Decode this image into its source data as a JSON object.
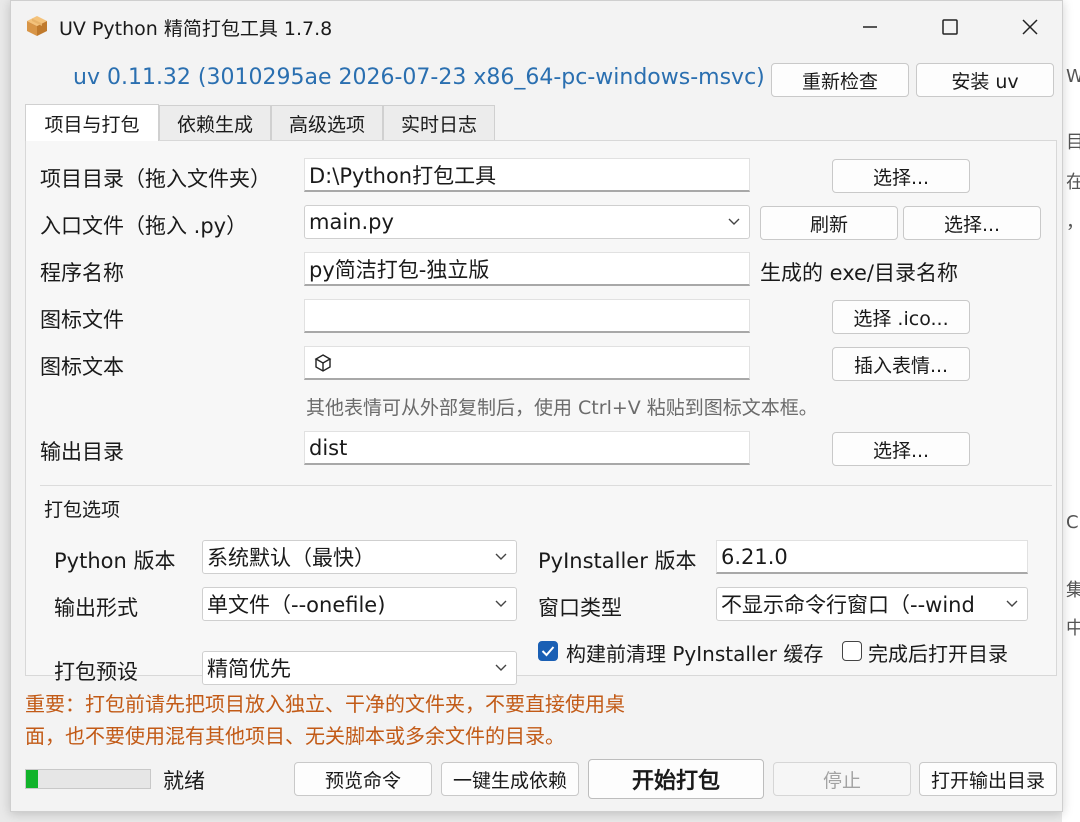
{
  "window": {
    "title": "UV Python 精简打包工具 1.7.8"
  },
  "header": {
    "version": "uv 0.11.32 (3010295ae 2026-07-23 x86_64-pc-windows-msvc)",
    "recheck_label": "重新检查",
    "install_label": "安装 uv"
  },
  "tabs": [
    {
      "label": "项目与打包",
      "active": true
    },
    {
      "label": "依赖生成",
      "active": false
    },
    {
      "label": "高级选项",
      "active": false
    },
    {
      "label": "实时日志",
      "active": false
    }
  ],
  "form": {
    "project_dir": {
      "label": "项目目录（拖入文件夹）",
      "value": "D:\\Python打包工具",
      "button": "选择..."
    },
    "entry_file": {
      "label": "入口文件（拖入 .py）",
      "value": "main.py",
      "refresh": "刷新",
      "button": "选择..."
    },
    "program_name": {
      "label": "程序名称",
      "value": "py简洁打包-独立版",
      "hint": "生成的 exe/目录名称"
    },
    "icon_file": {
      "label": "图标文件",
      "value": "",
      "button": "选择 .ico..."
    },
    "icon_text": {
      "label": "图标文本",
      "value": "",
      "button": "插入表情...",
      "hint": "其他表情可从外部复制后，使用 Ctrl+V 粘贴到图标文本框。"
    },
    "output_dir": {
      "label": "输出目录",
      "value": "dist",
      "button": "选择..."
    }
  },
  "pack_options": {
    "title": "打包选项",
    "python_version": {
      "label": "Python 版本",
      "value": "系统默认（最快）"
    },
    "pyinstaller_version": {
      "label": "PyInstaller 版本",
      "value": "6.21.0"
    },
    "output_form": {
      "label": "输出形式",
      "value": "单文件（--onefile)"
    },
    "window_type": {
      "label": "窗口类型",
      "value": "不显示命令行窗口（--wind"
    },
    "preset": {
      "label": "打包预设",
      "value": "精简优先"
    },
    "clean_before_build": {
      "label": "构建前清理 PyInstaller 缓存",
      "checked": true
    },
    "open_after_build": {
      "label": "完成后打开目录",
      "checked": false
    }
  },
  "warning": {
    "line1": "重要：打包前请先把项目放入独立、干净的文件夹，不要直接使用桌",
    "line2": "面，也不要使用混有其他项目、无关脚本或多余文件的目录。"
  },
  "footer": {
    "progress": 0.1,
    "status": "就绪",
    "preview_label": "预览命令",
    "gen_deps_label": "一键生成依赖",
    "start_label": "开始打包",
    "stop_label": "停止",
    "open_output_label": "打开输出目录"
  },
  "colors": {
    "accent": "#1a5fb4",
    "version_text": "#2a6fb0",
    "warning_text": "#c25a16",
    "progress_fill": "#11b32a"
  }
}
